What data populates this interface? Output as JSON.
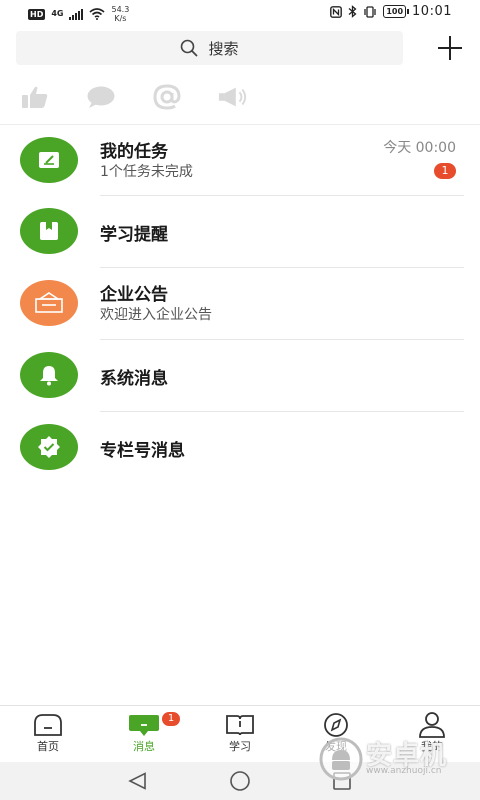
{
  "status_bar": {
    "hd": "HD",
    "network": "4G",
    "speed_value": "54.3",
    "speed_unit": "K/s",
    "battery": "100",
    "time": "10:01"
  },
  "search": {
    "label": "搜索"
  },
  "quick_icons": [
    "thumbs-up-icon",
    "chat-bubble-icon",
    "at-sign-icon",
    "megaphone-icon"
  ],
  "messages": [
    {
      "icon": "edit-icon",
      "color": "#4aa526",
      "title": "我的任务",
      "subtitle": "1个任务未完成",
      "time": "今天 00:00",
      "badge": "1"
    },
    {
      "icon": "bookmark-icon",
      "color": "#4aa526",
      "title": "学习提醒",
      "subtitle": ""
    },
    {
      "icon": "notice-board-icon",
      "color": "#f2884c",
      "title": "企业公告",
      "subtitle": "欢迎进入企业公告"
    },
    {
      "icon": "bell-icon",
      "color": "#4aa526",
      "title": "系统消息",
      "subtitle": ""
    },
    {
      "icon": "verified-badge-icon",
      "color": "#4aa526",
      "title": "专栏号消息",
      "subtitle": ""
    }
  ],
  "bottom_nav": {
    "items": [
      {
        "label": "首页",
        "icon": "home-icon"
      },
      {
        "label": "消息",
        "icon": "message-icon",
        "badge": "1"
      },
      {
        "label": "学习",
        "icon": "book-icon"
      },
      {
        "label": "发现",
        "icon": "compass-icon"
      },
      {
        "label": "我的",
        "icon": "profile-icon"
      }
    ],
    "active": "消息"
  },
  "watermark": {
    "text": "安卓机",
    "url": "www.anzhuoji.cn"
  },
  "colors": {
    "accent": "#4aa526",
    "orange": "#f2884c",
    "badge": "#e74c2c"
  }
}
